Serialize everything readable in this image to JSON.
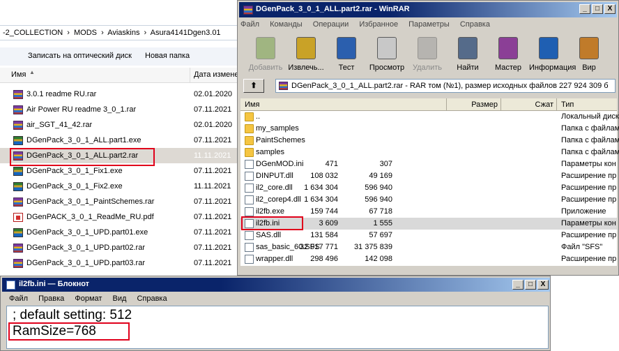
{
  "explorer": {
    "address_parts": [
      "-2_COLLECTION",
      "›",
      "MODS",
      "›",
      "Aviaskins",
      "›",
      "Asura4141Dgen3.01"
    ],
    "toolbar": [
      "Записать на оптический диск",
      "Новая папка"
    ],
    "columns": {
      "name": "Имя",
      "date": "Дата измене"
    },
    "files": [
      {
        "name": "3.0.1 readme RU.rar",
        "date": "02.01.2020",
        "icon": "rar-icon"
      },
      {
        "name": "Air Power RU readme 3_0_1.rar",
        "date": "07.11.2021",
        "icon": "rar-icon"
      },
      {
        "name": "air_SGT_41_42.rar",
        "date": "02.01.2020",
        "icon": "rar-icon"
      },
      {
        "name": "DGenPack_3_0_1_ALL.part1.exe",
        "date": "07.11.2021",
        "icon": "exe-icon"
      },
      {
        "name": "DGenPack_3_0_1_ALL.part2.rar",
        "date": "11.11.2021",
        "icon": "rar-icon",
        "selected": true
      },
      {
        "name": "DGenPack_3_0_1_Fix1.exe",
        "date": "07.11.2021",
        "icon": "exe-icon"
      },
      {
        "name": "DGenPack_3_0_1_Fix2.exe",
        "date": "11.11.2021",
        "icon": "exe-icon"
      },
      {
        "name": "DGenPack_3_0_1_PaintSchemes.rar",
        "date": "07.11.2021",
        "icon": "rar-icon"
      },
      {
        "name": "DGenPACK_3_0_1_ReadMe_RU.pdf",
        "date": "07.11.2021",
        "icon": "pdf-icon"
      },
      {
        "name": "DGenPack_3_0_1_UPD.part01.exe",
        "date": "07.11.2021",
        "icon": "exe-icon"
      },
      {
        "name": "DGenPack_3_0_1_UPD.part02.rar",
        "date": "07.11.2021",
        "icon": "rar-icon"
      },
      {
        "name": "DGenPack_3_0_1_UPD.part03.rar",
        "date": "07.11.2021",
        "icon": "rar-icon"
      }
    ]
  },
  "winrar": {
    "title": "DGenPack_3_0_1_ALL.part2.rar - WinRAR",
    "menu": [
      "Файл",
      "Команды",
      "Операции",
      "Избранное",
      "Параметры",
      "Справка"
    ],
    "tools": [
      {
        "label": "Добавить",
        "icon": "add-icon",
        "disabled": true
      },
      {
        "label": "Извлечь...",
        "icon": "extract-icon",
        "disabled": false
      },
      {
        "label": "Тест",
        "icon": "test-icon",
        "disabled": false
      },
      {
        "label": "Просмотр",
        "icon": "view-icon",
        "disabled": false
      },
      {
        "label": "Удалить",
        "icon": "delete-icon",
        "disabled": true
      },
      {
        "label": "Найти",
        "icon": "find-icon",
        "disabled": false
      },
      {
        "label": "Мастер",
        "icon": "wizard-icon",
        "disabled": false
      },
      {
        "label": "Информация",
        "icon": "info-icon",
        "disabled": false
      },
      {
        "label": "Вир",
        "icon": "virus-icon",
        "disabled": false
      }
    ],
    "path": "DGenPack_3_0_1_ALL.part2.rar - RAR том (№1), размер исходных файлов 227 924 309 б",
    "columns": {
      "name": "Имя",
      "size": "Размер",
      "packed": "Сжат",
      "type": "Тип"
    },
    "files": [
      {
        "name": "..",
        "size": "",
        "packed": "",
        "type": "Локальный диск",
        "icon": "folder-icon"
      },
      {
        "name": "my_samples",
        "size": "",
        "packed": "",
        "type": "Папка с файлам",
        "icon": "folder-icon"
      },
      {
        "name": "PaintSchemes",
        "size": "",
        "packed": "",
        "type": "Папка с файлам",
        "icon": "folder-icon"
      },
      {
        "name": "samples",
        "size": "",
        "packed": "",
        "type": "Папка с файлам",
        "icon": "folder-icon"
      },
      {
        "name": "DGenMOD.ini",
        "size": "471",
        "packed": "307",
        "type": "Параметры кон",
        "icon": "ini-icon"
      },
      {
        "name": "DINPUT.dll",
        "size": "108 032",
        "packed": "49 169",
        "type": "Расширение пр",
        "icon": "dll-icon"
      },
      {
        "name": "il2_core.dll",
        "size": "1 634 304",
        "packed": "596 940",
        "type": "Расширение пр",
        "icon": "dll-icon"
      },
      {
        "name": "il2_corep4.dll",
        "size": "1 634 304",
        "packed": "596 940",
        "type": "Расширение пр",
        "icon": "dll-icon"
      },
      {
        "name": "il2fb.exe",
        "size": "159 744",
        "packed": "67 718",
        "type": "Приложение",
        "icon": "exe-icon"
      },
      {
        "name": "il2fb.ini",
        "size": "3 609",
        "packed": "1 555",
        "type": "Параметры кон",
        "icon": "ini-icon",
        "selected": true
      },
      {
        "name": "SAS.dll",
        "size": "131 584",
        "packed": "57 697",
        "type": "Расширение пр",
        "icon": "dll-icon"
      },
      {
        "name": "sas_basic_60.SFS",
        "size": "32 917 771",
        "packed": "31 375 839",
        "type": "Файл \"SFS\"",
        "icon": "file-icon"
      },
      {
        "name": "wrapper.dll",
        "size": "298 496",
        "packed": "142 098",
        "type": "Расширение пр",
        "icon": "dll-icon"
      }
    ]
  },
  "notepad": {
    "title": "il2fb.ini — Блокнот",
    "menu": [
      "Файл",
      "Правка",
      "Формат",
      "Вид",
      "Справка"
    ],
    "lines": [
      "; default setting: 512",
      "RamSize=768"
    ]
  },
  "window_buttons": [
    "_",
    "□",
    "X"
  ],
  "colors": {
    "highlight": "#e0001b",
    "titlebar": "#0a246a"
  }
}
